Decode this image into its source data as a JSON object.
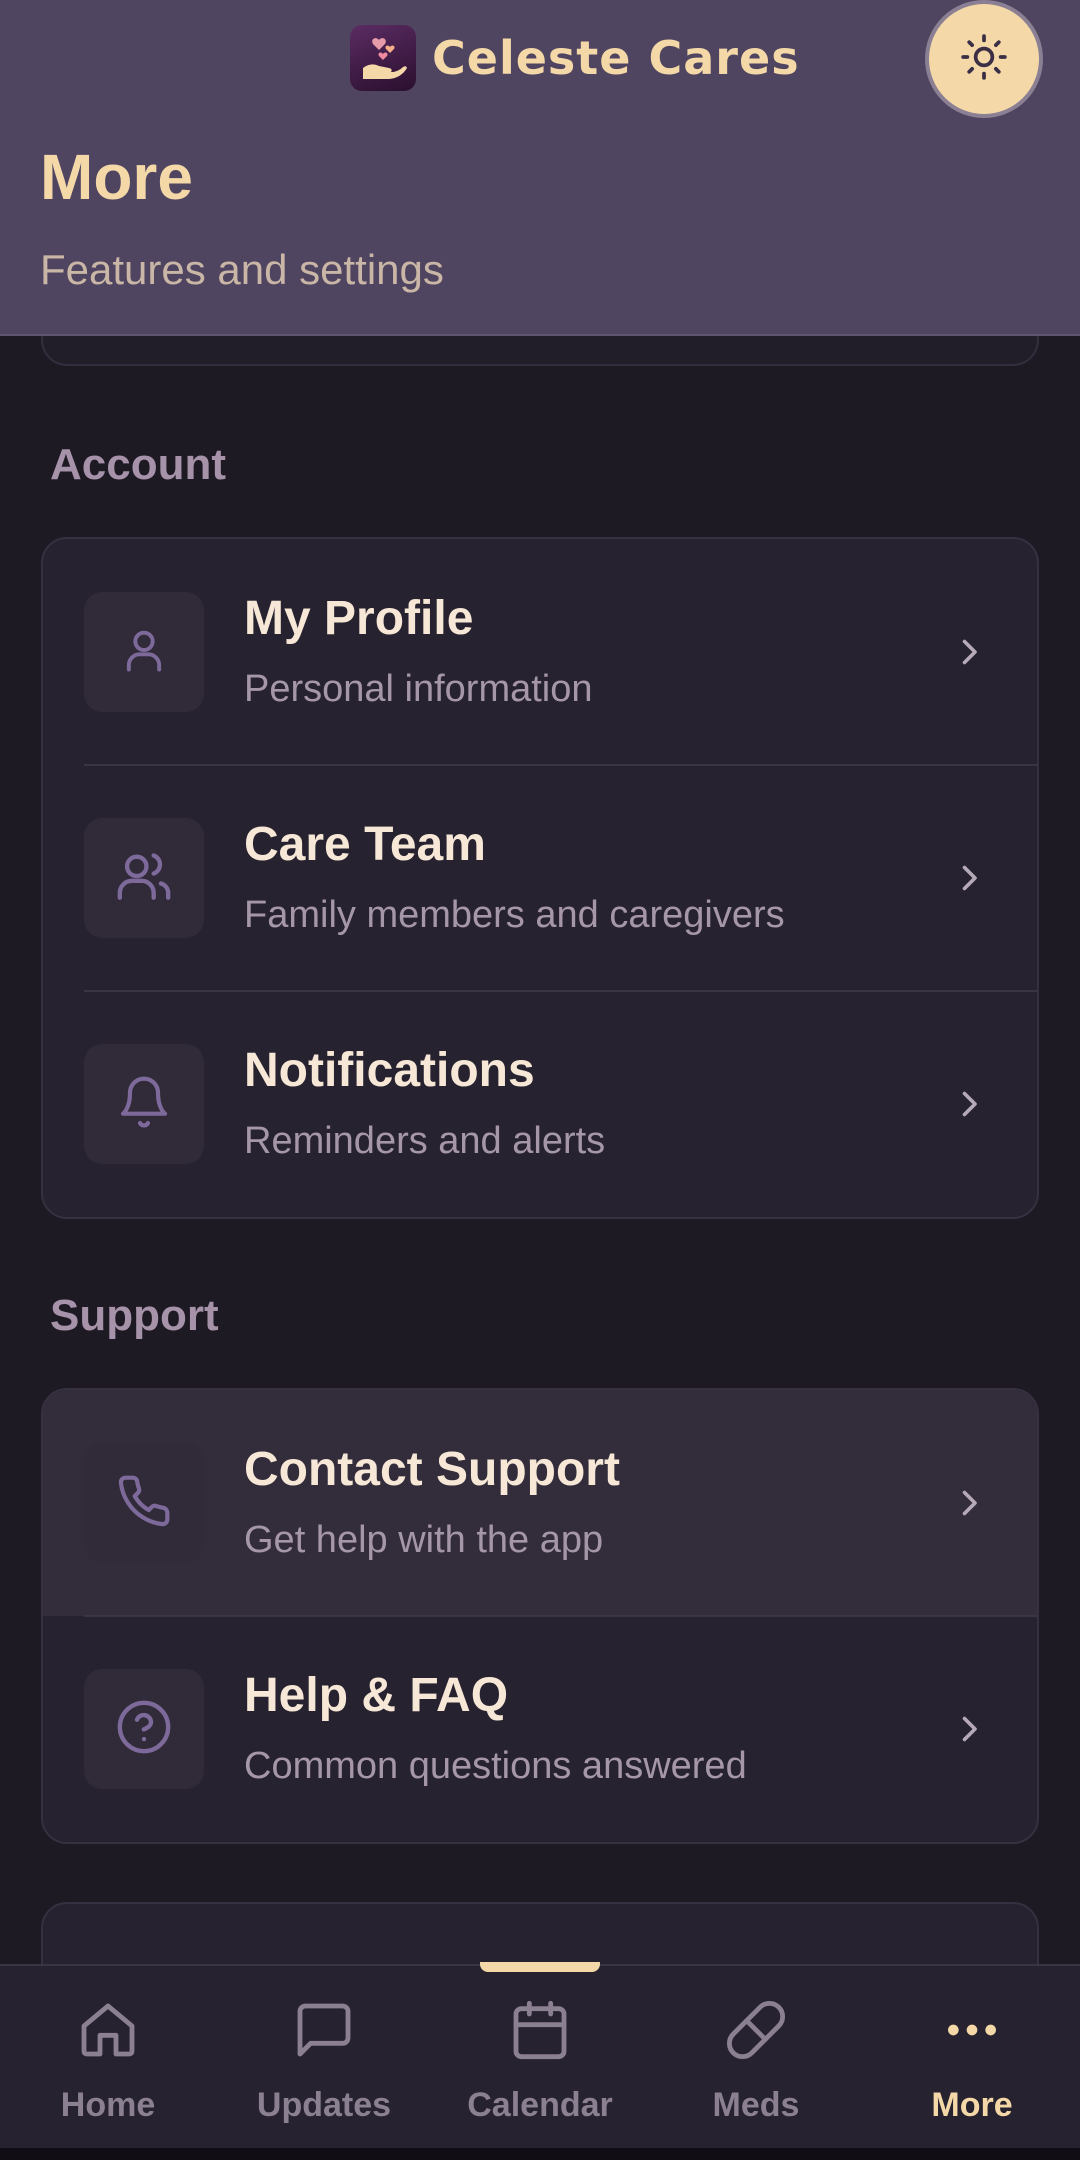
{
  "app": {
    "name": "Celeste Cares"
  },
  "header": {
    "title": "More",
    "subtitle": "Features and settings",
    "theme_toggle_icon": "sun-icon"
  },
  "sections": [
    {
      "label": "Account",
      "items": [
        {
          "title": "My Profile",
          "subtitle": "Personal information",
          "icon": "user-icon"
        },
        {
          "title": "Care Team",
          "subtitle": "Family members and caregivers",
          "icon": "users-icon"
        },
        {
          "title": "Notifications",
          "subtitle": "Reminders and alerts",
          "icon": "bell-icon"
        }
      ]
    },
    {
      "label": "Support",
      "items": [
        {
          "title": "Contact Support",
          "subtitle": "Get help with the app",
          "icon": "phone-icon"
        },
        {
          "title": "Help & FAQ",
          "subtitle": "Common questions answered",
          "icon": "help-circle-icon"
        }
      ]
    }
  ],
  "nav": {
    "items": [
      {
        "label": "Home",
        "icon": "home-icon"
      },
      {
        "label": "Updates",
        "icon": "message-icon"
      },
      {
        "label": "Calendar",
        "icon": "calendar-icon"
      },
      {
        "label": "Meds",
        "icon": "pill-icon"
      },
      {
        "label": "More",
        "icon": "more-icon",
        "active": true
      }
    ]
  },
  "colors": {
    "header_bg": "#4f4560",
    "accent": "#f5d8a8",
    "page_bg": "#1e1a24",
    "card_bg": "#27222f",
    "icon_color": "#7d6a9a"
  }
}
